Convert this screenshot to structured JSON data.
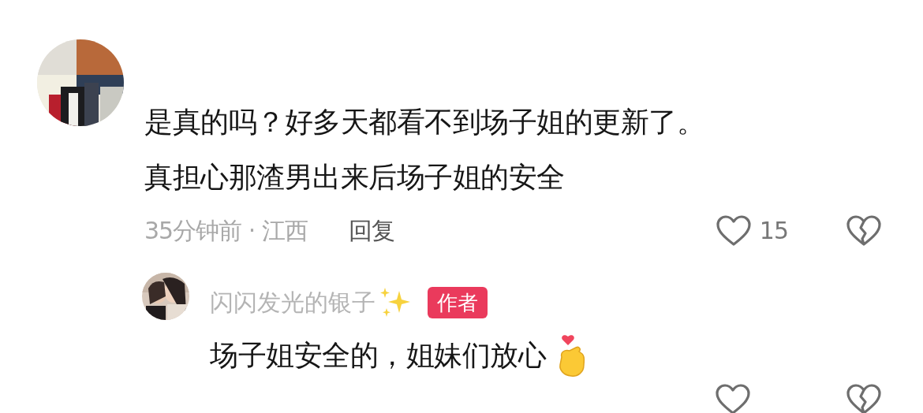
{
  "comments": [
    {
      "avatar": {
        "kind": "picture"
      },
      "lines": [
        "是真的吗？好多天都看不到场子姐的更新了。",
        "真担心那渣男出来后场子姐的安全"
      ],
      "time_location": "35分钟前 · 江西",
      "reply_label": "回复",
      "likes": "15",
      "liked": false,
      "replies": [
        {
          "avatar": {
            "kind": "picture"
          },
          "author": "闪闪发光的银子",
          "author_badge": "作者",
          "text": "场子姐安全的，姐妹们放心",
          "liked": false
        }
      ]
    }
  ]
}
